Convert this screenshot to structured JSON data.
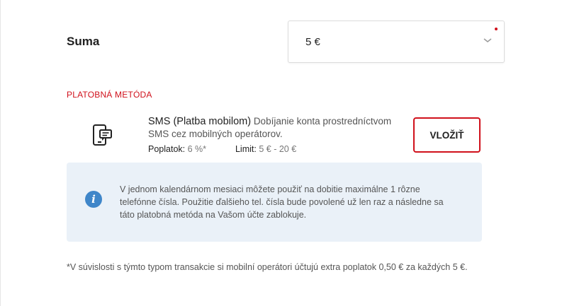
{
  "amount": {
    "label": "Suma",
    "selected_value": "5 €"
  },
  "payment_method": {
    "section_title": "PLATOBNÁ METÓDA",
    "name": "SMS (Platba mobilom)",
    "description": "Dobíjanie konta prostredníctvom SMS cez mobilných operátorov.",
    "fee_label": "Poplatok:",
    "fee_value": "6 %*",
    "limit_label": "Limit:",
    "limit_value": "5 € - 20 €",
    "button_label": "VLOŽIŤ",
    "icon": "mobile-sms-icon"
  },
  "info": {
    "icon": "info-icon",
    "icon_glyph": "i",
    "text": "V jednom kalendárnom mesiaci môžete použiť na dobitie maximálne 1 rôzne telefónne čísla. Použitie ďalšieho tel. čísla bude povolené už len raz a následne sa táto platobná metóda na Vašom účte zablokuje."
  },
  "footnote": "*V súvislosti s týmto typom transakcie si mobilní operátori účtujú extra poplatok 0,50 € za každých 5 €.",
  "colors": {
    "accent_red": "#d0101b",
    "info_blue": "#3f86c9",
    "info_bg": "#eaf1f8"
  }
}
